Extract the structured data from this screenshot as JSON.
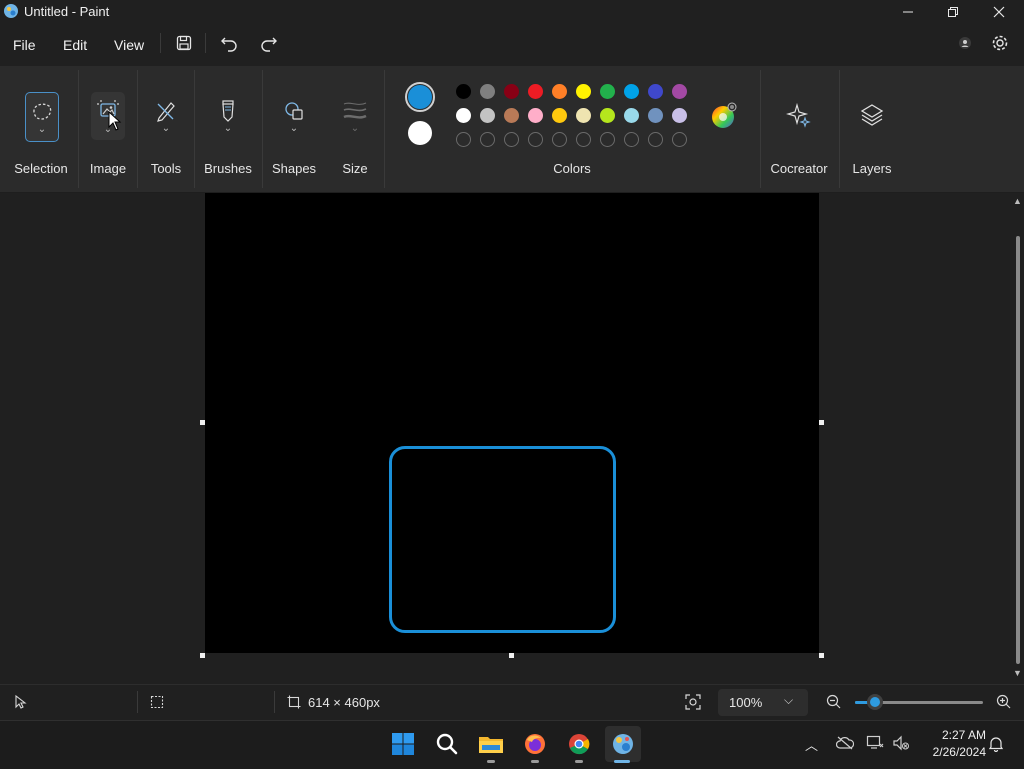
{
  "window": {
    "title": "Untitled - Paint"
  },
  "menu": {
    "file": "File",
    "edit": "Edit",
    "view": "View"
  },
  "ribbon": {
    "groups": {
      "selection": "Selection",
      "image": "Image",
      "tools": "Tools",
      "brushes": "Brushes",
      "shapes": "Shapes",
      "size": "Size",
      "colors": "Colors",
      "cocreator": "Cocreator",
      "layers": "Layers"
    },
    "primary_color": "#1a8fd8",
    "secondary_color": "#ffffff",
    "palette_row1": [
      "#000000",
      "#7f7f7f",
      "#880015",
      "#ed1c24",
      "#ff7f27",
      "#fff200",
      "#22b14c",
      "#00a2e8",
      "#3f48cc",
      "#a349a4"
    ],
    "palette_row2": [
      "#ffffff",
      "#c3c3c3",
      "#b97a57",
      "#ffaec9",
      "#ffc90e",
      "#efe4b0",
      "#b5e61d",
      "#99d9ea",
      "#7092be",
      "#c8bfe7"
    ]
  },
  "canvas": {
    "shape_color": "#1a8fd8"
  },
  "status": {
    "canvas_size": "614 × 460px",
    "zoom": "100%"
  },
  "taskbar": {
    "time": "2:27 AM",
    "date": "2/26/2024"
  }
}
